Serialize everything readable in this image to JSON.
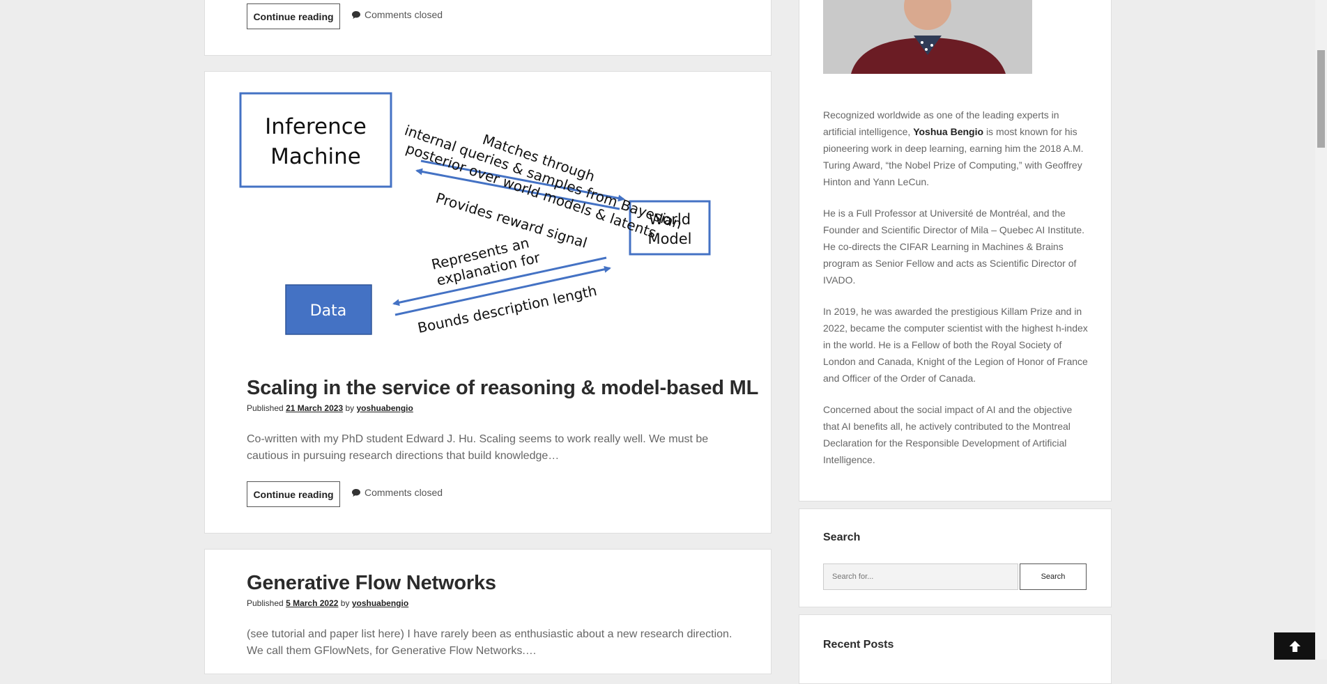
{
  "posts": [
    {
      "continue_label": "Continue reading",
      "comments_label": "Comments closed"
    },
    {
      "figure": {
        "inference_machine": [
          "Inference",
          "Machine"
        ],
        "world_model": [
          "World",
          "Model"
        ],
        "data": "Data",
        "arrow_top_lines": [
          "Matches through",
          "internal queries & samples from Bayesian",
          "posterior over world models & latents"
        ],
        "arrow_reward": "Provides reward signal",
        "arrow_represents": [
          "Represents an",
          "explanation for"
        ],
        "arrow_bounds": "Bounds description length"
      },
      "title": "Scaling in the service of reasoning & model-based ML",
      "published_label": "Published",
      "date": "21 March 2023",
      "by_label": "by",
      "author": "yoshuabengio",
      "excerpt": "Co-written with my PhD student Edward J. Hu. Scaling seems to work really well. We must be cautious in pursuing research directions that build knowledge…",
      "continue_label": "Continue reading",
      "comments_label": "Comments closed"
    },
    {
      "title": "Generative Flow Networks",
      "published_label": "Published",
      "date": "5 March 2022",
      "by_label": "by",
      "author": "yoshuabengio",
      "excerpt": "(see tutorial and paper list here) I have rarely been as enthusiastic about a new research direction. We call them GFlowNets, for Generative Flow Networks.…"
    }
  ],
  "sidebar": {
    "bio": {
      "p1_before": "Recognized worldwide as one of the leading experts in artificial intelligence,",
      "p1_name": "Yoshua Bengio",
      "p1_after": "is most known for his pioneering work in deep learning, earning him the 2018 A.M. Turing Award, “the Nobel Prize of Computing,” with Geoffrey Hinton and Yann LeCun.",
      "p2": "He is a Full Professor at Université de Montréal, and the Founder and Scientific Director of Mila – Quebec AI Institute. He co-directs the CIFAR Learning in Machines & Brains program as Senior Fellow and acts as Scientific Director of IVADO.",
      "p3": "In 2019, he was awarded the prestigious Killam Prize and in 2022, became the computer scientist with the highest h-index in the world. He is a Fellow of both the Royal Society of London and Canada, Knight of the Legion of Honor of France and Officer of the Order of Canada.",
      "p4": "Concerned about the social impact of AI and the objective that AI benefits all, he actively contributed to the Montreal Declaration for the Responsible Development of Artificial Intelligence."
    },
    "search": {
      "title": "Search",
      "placeholder": "Search for...",
      "button": "Search"
    },
    "recent_posts_title": "Recent Posts"
  },
  "icons": {
    "comment": "comment-icon",
    "back_to_top": "arrow-up-icon"
  },
  "colors": {
    "diagram_blue": "#4472c4",
    "background": "#ededed"
  }
}
